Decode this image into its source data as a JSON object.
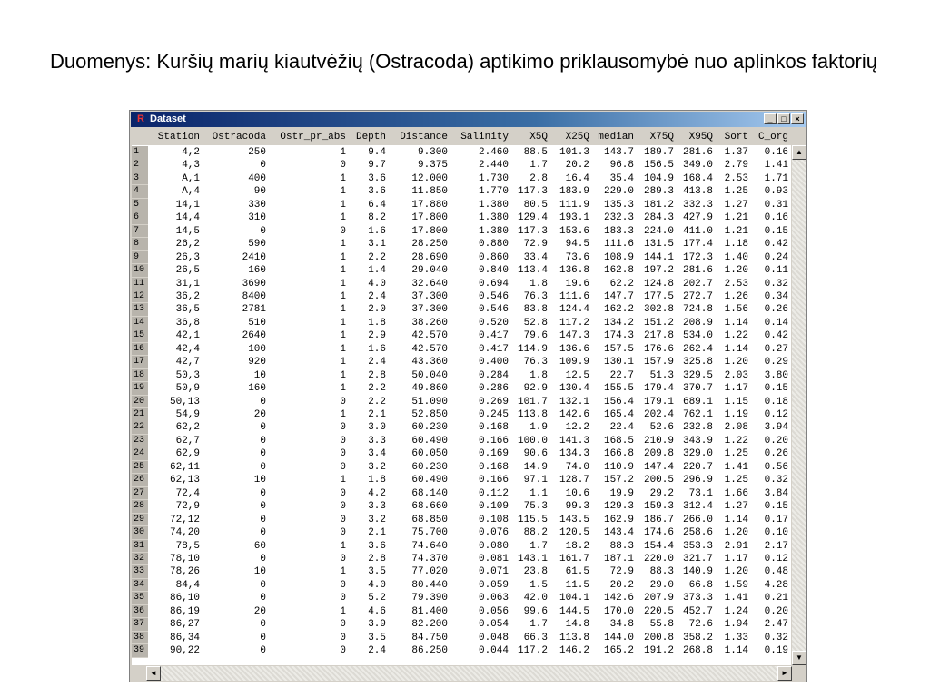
{
  "slide": {
    "title": "Duomenys: Kuršių marių kiautvėžių (Ostracoda) aptikimo priklausomybė nuo aplinkos faktorių"
  },
  "window": {
    "title": "Dataset",
    "icon": "r-app-icon",
    "controls": {
      "minimize": "_",
      "maximize": "□",
      "close": "×"
    }
  },
  "table": {
    "columns": [
      "Station",
      "Ostracoda",
      "Ostr_pr_abs",
      "Depth",
      "Distance",
      "Salinity",
      "X5Q",
      "X25Q",
      "median",
      "X75Q",
      "X95Q",
      "Sort",
      "C_org"
    ],
    "rows": [
      [
        "1",
        "4,2",
        "250",
        "1",
        "9.4",
        "9.300",
        "2.460",
        "88.5",
        "101.3",
        "143.7",
        "189.7",
        "281.6",
        "1.37",
        "0.16"
      ],
      [
        "2",
        "4,3",
        "0",
        "0",
        "9.7",
        "9.375",
        "2.440",
        "1.7",
        "20.2",
        "96.8",
        "156.5",
        "349.0",
        "2.79",
        "1.41"
      ],
      [
        "3",
        "A,1",
        "400",
        "1",
        "3.6",
        "12.000",
        "1.730",
        "2.8",
        "16.4",
        "35.4",
        "104.9",
        "168.4",
        "2.53",
        "1.71"
      ],
      [
        "4",
        "A,4",
        "90",
        "1",
        "3.6",
        "11.850",
        "1.770",
        "117.3",
        "183.9",
        "229.0",
        "289.3",
        "413.8",
        "1.25",
        "0.93"
      ],
      [
        "5",
        "14,1",
        "330",
        "1",
        "6.4",
        "17.880",
        "1.380",
        "80.5",
        "111.9",
        "135.3",
        "181.2",
        "332.3",
        "1.27",
        "0.31"
      ],
      [
        "6",
        "14,4",
        "310",
        "1",
        "8.2",
        "17.800",
        "1.380",
        "129.4",
        "193.1",
        "232.3",
        "284.3",
        "427.9",
        "1.21",
        "0.16"
      ],
      [
        "7",
        "14,5",
        "0",
        "0",
        "1.6",
        "17.800",
        "1.380",
        "117.3",
        "153.6",
        "183.3",
        "224.0",
        "411.0",
        "1.21",
        "0.15"
      ],
      [
        "8",
        "26,2",
        "590",
        "1",
        "3.1",
        "28.250",
        "0.880",
        "72.9",
        "94.5",
        "111.6",
        "131.5",
        "177.4",
        "1.18",
        "0.42"
      ],
      [
        "9",
        "26,3",
        "2410",
        "1",
        "2.2",
        "28.690",
        "0.860",
        "33.4",
        "73.6",
        "108.9",
        "144.1",
        "172.3",
        "1.40",
        "0.24"
      ],
      [
        "10",
        "26,5",
        "160",
        "1",
        "1.4",
        "29.040",
        "0.840",
        "113.4",
        "136.8",
        "162.8",
        "197.2",
        "281.6",
        "1.20",
        "0.11"
      ],
      [
        "11",
        "31,1",
        "3690",
        "1",
        "4.0",
        "32.640",
        "0.694",
        "1.8",
        "19.6",
        "62.2",
        "124.8",
        "202.7",
        "2.53",
        "0.32"
      ],
      [
        "12",
        "36,2",
        "8400",
        "1",
        "2.4",
        "37.300",
        "0.546",
        "76.3",
        "111.6",
        "147.7",
        "177.5",
        "272.7",
        "1.26",
        "0.34"
      ],
      [
        "13",
        "36,5",
        "2781",
        "1",
        "2.0",
        "37.300",
        "0.546",
        "83.8",
        "124.4",
        "162.2",
        "302.8",
        "724.8",
        "1.56",
        "0.26"
      ],
      [
        "14",
        "36,8",
        "510",
        "1",
        "1.8",
        "38.260",
        "0.520",
        "52.8",
        "117.2",
        "134.2",
        "151.2",
        "208.9",
        "1.14",
        "0.14"
      ],
      [
        "15",
        "42,1",
        "2640",
        "1",
        "2.9",
        "42.570",
        "0.417",
        "79.6",
        "147.3",
        "174.3",
        "217.8",
        "534.0",
        "1.22",
        "0.42"
      ],
      [
        "16",
        "42,4",
        "100",
        "1",
        "1.6",
        "42.570",
        "0.417",
        "114.9",
        "136.6",
        "157.5",
        "176.6",
        "262.4",
        "1.14",
        "0.27"
      ],
      [
        "17",
        "42,7",
        "920",
        "1",
        "2.4",
        "43.360",
        "0.400",
        "76.3",
        "109.9",
        "130.1",
        "157.9",
        "325.8",
        "1.20",
        "0.29"
      ],
      [
        "18",
        "50,3",
        "10",
        "1",
        "2.8",
        "50.040",
        "0.284",
        "1.8",
        "12.5",
        "22.7",
        "51.3",
        "329.5",
        "2.03",
        "3.80"
      ],
      [
        "19",
        "50,9",
        "160",
        "1",
        "2.2",
        "49.860",
        "0.286",
        "92.9",
        "130.4",
        "155.5",
        "179.4",
        "370.7",
        "1.17",
        "0.15"
      ],
      [
        "20",
        "50,13",
        "0",
        "0",
        "2.2",
        "51.090",
        "0.269",
        "101.7",
        "132.1",
        "156.4",
        "179.1",
        "689.1",
        "1.15",
        "0.18"
      ],
      [
        "21",
        "54,9",
        "20",
        "1",
        "2.1",
        "52.850",
        "0.245",
        "113.8",
        "142.6",
        "165.4",
        "202.4",
        "762.1",
        "1.19",
        "0.12"
      ],
      [
        "22",
        "62,2",
        "0",
        "0",
        "3.0",
        "60.230",
        "0.168",
        "1.9",
        "12.2",
        "22.4",
        "52.6",
        "232.8",
        "2.08",
        "3.94"
      ],
      [
        "23",
        "62,7",
        "0",
        "0",
        "3.3",
        "60.490",
        "0.166",
        "100.0",
        "141.3",
        "168.5",
        "210.9",
        "343.9",
        "1.22",
        "0.20"
      ],
      [
        "24",
        "62,9",
        "0",
        "0",
        "3.4",
        "60.050",
        "0.169",
        "90.6",
        "134.3",
        "166.8",
        "209.8",
        "329.0",
        "1.25",
        "0.26"
      ],
      [
        "25",
        "62,11",
        "0",
        "0",
        "3.2",
        "60.230",
        "0.168",
        "14.9",
        "74.0",
        "110.9",
        "147.4",
        "220.7",
        "1.41",
        "0.56"
      ],
      [
        "26",
        "62,13",
        "10",
        "1",
        "1.8",
        "60.490",
        "0.166",
        "97.1",
        "128.7",
        "157.2",
        "200.5",
        "296.9",
        "1.25",
        "0.32"
      ],
      [
        "27",
        "72,4",
        "0",
        "0",
        "4.2",
        "68.140",
        "0.112",
        "1.1",
        "10.6",
        "19.9",
        "29.2",
        "73.1",
        "1.66",
        "3.84"
      ],
      [
        "28",
        "72,9",
        "0",
        "0",
        "3.3",
        "68.660",
        "0.109",
        "75.3",
        "99.3",
        "129.3",
        "159.3",
        "312.4",
        "1.27",
        "0.15"
      ],
      [
        "29",
        "72,12",
        "0",
        "0",
        "3.2",
        "68.850",
        "0.108",
        "115.5",
        "143.5",
        "162.9",
        "186.7",
        "266.0",
        "1.14",
        "0.17"
      ],
      [
        "30",
        "74,20",
        "0",
        "0",
        "2.1",
        "75.700",
        "0.076",
        "88.2",
        "120.5",
        "143.4",
        "174.6",
        "258.6",
        "1.20",
        "0.10"
      ],
      [
        "31",
        "78,5",
        "60",
        "1",
        "3.6",
        "74.640",
        "0.080",
        "1.7",
        "18.2",
        "88.3",
        "154.4",
        "353.3",
        "2.91",
        "2.17"
      ],
      [
        "32",
        "78,10",
        "0",
        "0",
        "2.8",
        "74.370",
        "0.081",
        "143.1",
        "161.7",
        "187.1",
        "220.0",
        "321.7",
        "1.17",
        "0.12"
      ],
      [
        "33",
        "78,26",
        "10",
        "1",
        "3.5",
        "77.020",
        "0.071",
        "23.8",
        "61.5",
        "72.9",
        "88.3",
        "140.9",
        "1.20",
        "0.48"
      ],
      [
        "34",
        "84,4",
        "0",
        "0",
        "4.0",
        "80.440",
        "0.059",
        "1.5",
        "11.5",
        "20.2",
        "29.0",
        "66.8",
        "1.59",
        "4.28"
      ],
      [
        "35",
        "86,10",
        "0",
        "0",
        "5.2",
        "79.390",
        "0.063",
        "42.0",
        "104.1",
        "142.6",
        "207.9",
        "373.3",
        "1.41",
        "0.21"
      ],
      [
        "36",
        "86,19",
        "20",
        "1",
        "4.6",
        "81.400",
        "0.056",
        "99.6",
        "144.5",
        "170.0",
        "220.5",
        "452.7",
        "1.24",
        "0.20"
      ],
      [
        "37",
        "86,27",
        "0",
        "0",
        "3.9",
        "82.200",
        "0.054",
        "1.7",
        "14.8",
        "34.8",
        "55.8",
        "72.6",
        "1.94",
        "2.47"
      ],
      [
        "38",
        "86,34",
        "0",
        "0",
        "3.5",
        "84.750",
        "0.048",
        "66.3",
        "113.8",
        "144.0",
        "200.8",
        "358.2",
        "1.33",
        "0.32"
      ],
      [
        "39",
        "90,22",
        "0",
        "0",
        "2.4",
        "86.250",
        "0.044",
        "117.2",
        "146.2",
        "165.2",
        "191.2",
        "268.8",
        "1.14",
        "0.19"
      ]
    ]
  },
  "scrollbar": {
    "up": "▲",
    "down": "▼",
    "left": "◄",
    "right": "►"
  }
}
